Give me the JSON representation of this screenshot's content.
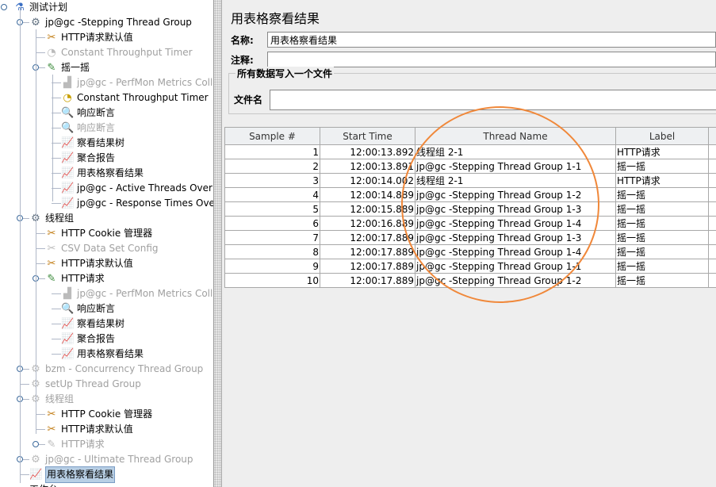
{
  "tree": [
    {
      "label": "测试计划",
      "level": 0,
      "icon": "flask-icon",
      "state": "normal",
      "expander": "open"
    },
    {
      "label": "jp@gc -Stepping Thread Group",
      "level": 1,
      "icon": "gear-icon",
      "state": "normal",
      "expander": "open"
    },
    {
      "label": "HTTP请求默认值",
      "level": 2,
      "icon": "wrench-icon",
      "state": "normal"
    },
    {
      "label": "Constant Throughput Timer",
      "level": 2,
      "icon": "timer-icon",
      "state": "disabled"
    },
    {
      "label": "摇一摇",
      "level": 2,
      "icon": "sampler-icon",
      "state": "normal",
      "expander": "open"
    },
    {
      "label": "jp@gc - PerfMon Metrics Collector",
      "level": 3,
      "icon": "chart-icon",
      "state": "disabled"
    },
    {
      "label": "Constant Throughput Timer",
      "level": 3,
      "icon": "timer-icon",
      "state": "normal"
    },
    {
      "label": "响应断言",
      "level": 3,
      "icon": "magnifier-icon",
      "state": "normal"
    },
    {
      "label": "响应断言",
      "level": 3,
      "icon": "magnifier-icon",
      "state": "disabled"
    },
    {
      "label": "察看结果树",
      "level": 3,
      "icon": "graph-icon",
      "state": "normal"
    },
    {
      "label": "聚合报告",
      "level": 3,
      "icon": "graph-icon",
      "state": "normal"
    },
    {
      "label": "用表格察看结果",
      "level": 3,
      "icon": "graph-icon",
      "state": "normal"
    },
    {
      "label": "jp@gc - Active Threads Over Time",
      "level": 3,
      "icon": "graph-icon",
      "state": "normal"
    },
    {
      "label": "jp@gc - Response Times Over Time",
      "level": 3,
      "icon": "graph-icon",
      "state": "normal"
    },
    {
      "label": "线程组",
      "level": 1,
      "icon": "gear-icon",
      "state": "normal",
      "expander": "open"
    },
    {
      "label": "HTTP Cookie 管理器",
      "level": 2,
      "icon": "wrench-icon",
      "state": "normal"
    },
    {
      "label": "CSV Data Set Config",
      "level": 2,
      "icon": "wrench-icon",
      "state": "disabled"
    },
    {
      "label": "HTTP请求默认值",
      "level": 2,
      "icon": "wrench-icon",
      "state": "normal"
    },
    {
      "label": "HTTP请求",
      "level": 2,
      "icon": "sampler-icon",
      "state": "normal",
      "expander": "open"
    },
    {
      "label": "jp@gc - PerfMon Metrics Collector",
      "level": 3,
      "icon": "chart-icon",
      "state": "disabled"
    },
    {
      "label": "响应断言",
      "level": 3,
      "icon": "magnifier-icon",
      "state": "normal"
    },
    {
      "label": "察看结果树",
      "level": 3,
      "icon": "graph-icon",
      "state": "normal"
    },
    {
      "label": "聚合报告",
      "level": 3,
      "icon": "graph-icon",
      "state": "normal"
    },
    {
      "label": "用表格察看结果",
      "level": 3,
      "icon": "graph-icon",
      "state": "normal"
    },
    {
      "label": "bzm - Concurrency Thread Group",
      "level": 1,
      "icon": "gear-icon",
      "state": "disabled",
      "expander": "closed"
    },
    {
      "label": "setUp Thread Group",
      "level": 1,
      "icon": "gear-icon",
      "state": "disabled"
    },
    {
      "label": "线程组",
      "level": 1,
      "icon": "gear-icon",
      "state": "disabled",
      "expander": "open"
    },
    {
      "label": "HTTP Cookie 管理器",
      "level": 2,
      "icon": "wrench-icon",
      "state": "normal"
    },
    {
      "label": "HTTP请求默认值",
      "level": 2,
      "icon": "wrench-icon",
      "state": "normal"
    },
    {
      "label": "HTTP请求",
      "level": 2,
      "icon": "sampler-icon",
      "state": "disabled",
      "expander": "closed"
    },
    {
      "label": "jp@gc - Ultimate Thread Group",
      "level": 1,
      "icon": "gear-icon",
      "state": "disabled",
      "expander": "closed"
    },
    {
      "label": "用表格察看结果",
      "level": 1,
      "icon": "graph-icon",
      "state": "selected"
    },
    {
      "label": "工作台",
      "level": 0,
      "icon": "workbench-icon",
      "state": "normal"
    }
  ],
  "panel": {
    "title": "用表格察看结果",
    "name_label": "名称:",
    "name_value": "用表格察看结果",
    "comment_label": "注释:",
    "comment_value": "",
    "file_section": "所有数据写入一个文件",
    "file_label": "文件名",
    "file_value": ""
  },
  "table": {
    "columns": [
      "Sample #",
      "Start Time",
      "Thread Name",
      "Label",
      "S"
    ],
    "rows": [
      [
        "1",
        "12:00:13.892",
        "线程组 2-1",
        "HTTP请求"
      ],
      [
        "2",
        "12:00:13.891",
        "jp@gc -Stepping Thread Group 1-1",
        "摇一摇"
      ],
      [
        "3",
        "12:00:14.002",
        "线程组 2-1",
        "HTTP请求"
      ],
      [
        "4",
        "12:00:14.889",
        "jp@gc -Stepping Thread Group 1-2",
        "摇一摇"
      ],
      [
        "5",
        "12:00:15.889",
        "jp@gc -Stepping Thread Group 1-3",
        "摇一摇"
      ],
      [
        "6",
        "12:00:16.889",
        "jp@gc -Stepping Thread Group 1-4",
        "摇一摇"
      ],
      [
        "7",
        "12:00:17.889",
        "jp@gc -Stepping Thread Group 1-3",
        "摇一摇"
      ],
      [
        "8",
        "12:00:17.889",
        "jp@gc -Stepping Thread Group 1-4",
        "摇一摇"
      ],
      [
        "9",
        "12:00:17.889",
        "jp@gc -Stepping Thread Group 1-1",
        "摇一摇"
      ],
      [
        "10",
        "12:00:17.889",
        "jp@gc -Stepping Thread Group 1-2",
        "摇一摇"
      ]
    ]
  },
  "colors": {
    "annotation_circle": "#f0883a",
    "selection": "#b8cfe5"
  }
}
